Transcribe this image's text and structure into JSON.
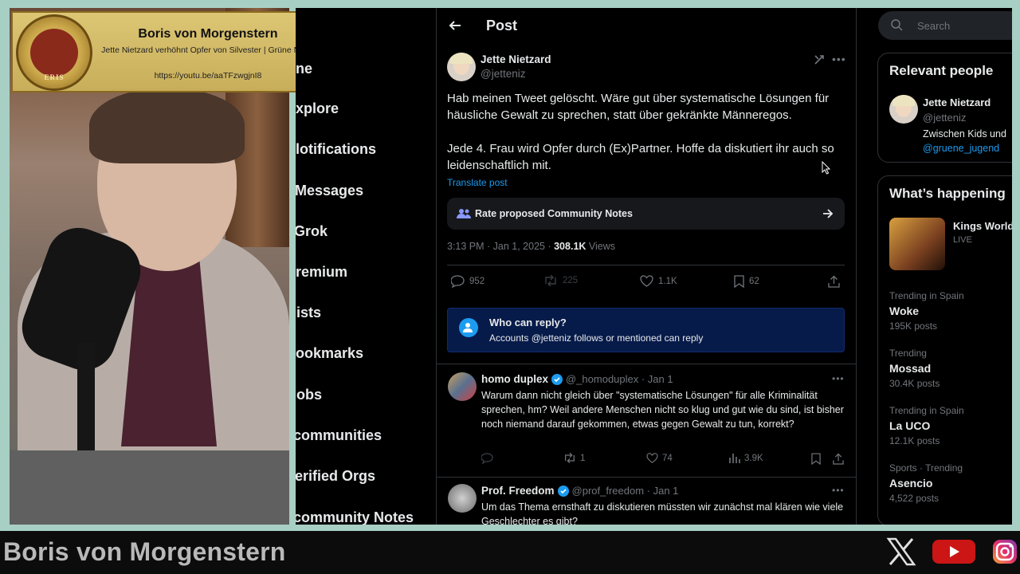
{
  "overlay": {
    "banner_title": "Boris von Morgenstern",
    "banner_subtitle": "Jette Nietzard verhöhnt Opfer von Silvester | Grüne Moral",
    "banner_url": "https://youtu.be/aaTFzwgjnI8",
    "logo_text": "ERIS",
    "bottom_name": "Boris von Morgenstern"
  },
  "nav": {
    "items": [
      "ne",
      "xplore",
      "lotifications",
      "Messages",
      "Grok",
      "remium",
      "ists",
      "ookmarks",
      "obs",
      "communities",
      "erified Orgs",
      "community Notes"
    ]
  },
  "post": {
    "header_title": "Post",
    "author_name": "Jette Nietzard",
    "author_handle": "@jetteniz",
    "text_p1": "Hab meinen Tweet gelöscht. Wäre gut über systematische Lösungen für häusliche Gewalt zu sprechen, statt über gekränkte Männeregos.",
    "text_p2": "Jede 4. Frau wird Opfer durch (Ex)Partner. Hoffe da diskutiert ihr auch so leidenschaftlich mit.",
    "translate_label": "Translate post",
    "community_notes_label": "Rate proposed Community Notes",
    "time": "3:13 PM · Jan 1, 2025 · ",
    "views_count": "308.1K",
    "views_label": " Views",
    "replies": "952",
    "reposts": "225",
    "likes": "1.1K",
    "bookmarks": "62",
    "who_can_reply_title": "Who can reply?",
    "who_can_reply_text": "Accounts @jetteniz follows or mentioned can reply"
  },
  "replies": [
    {
      "name": "homo duplex",
      "handle": "@_homoduplex · Jan 1",
      "text": "Warum dann nicht gleich über \"systematische Lösungen\" für alle Kriminalität sprechen, hm? Weil andere Menschen nicht so klug und gut wie du sind, ist bisher noch niemand darauf gekommen, etwas gegen Gewalt zu tun, korrekt?",
      "reposts": "1",
      "likes": "74",
      "views": "3.9K"
    },
    {
      "name": "Prof. Freedom",
      "handle": "@prof_freedom · Jan 1",
      "text": "Um das Thema ernsthaft zu diskutieren müssten wir zunächst mal klären wie viele Geschlechter es gibt?"
    }
  ],
  "sidebar": {
    "search_placeholder": "Search",
    "relevant_title": "Relevant people",
    "person_name": "Jette Nietzard",
    "person_handle": "@jetteniz",
    "person_bio": "Zwischen Kids und",
    "person_link": "@gruene_jugend",
    "happening_title": "What’s happening",
    "live_title": "Kings World",
    "live_label": "LIVE",
    "trends": [
      {
        "meta": "Trending in Spain",
        "name": "Woke",
        "count": "195K posts"
      },
      {
        "meta": "Trending",
        "name": "Mossad",
        "count": "30.4K posts"
      },
      {
        "meta": "Trending in Spain",
        "name": "La UCO",
        "count": "12.1K posts"
      },
      {
        "meta": "Sports · Trending",
        "name": "Asencio",
        "count": "4,522 posts"
      }
    ]
  },
  "colors": {
    "accent": "#1d9bf0",
    "background": "#000000",
    "muted": "#71767b",
    "banner_gold": "#d4bd6a"
  }
}
